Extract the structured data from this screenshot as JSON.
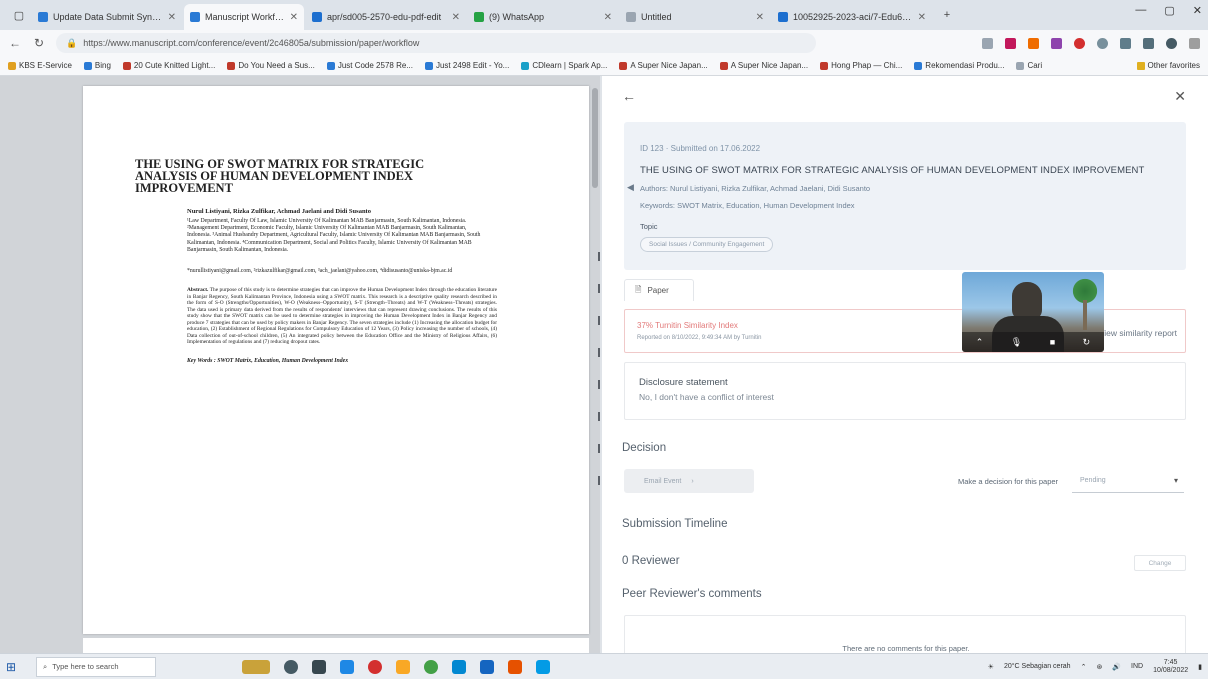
{
  "browser": {
    "tabs": [
      {
        "label": "Update Data Submit Synopsis",
        "color": "#2a7ad5",
        "active": false
      },
      {
        "label": "Manuscript Workflow",
        "color": "#2a7ad5",
        "active": true
      },
      {
        "label": "apr/sd005-2570-edu-pdf-edit",
        "color": "#1d6fcf",
        "active": false
      },
      {
        "label": "(9) WhatsApp",
        "color": "#25a244",
        "active": false
      },
      {
        "label": "Untitled",
        "color": "#9aa5b1",
        "active": false
      },
      {
        "label": "10052925-2023-aci/7-Edu6-PRt",
        "color": "#1d6fcf",
        "active": false
      }
    ],
    "url": "https://www.manuscript.com/conference/event/2c46805a/submission/paper/workflow",
    "bookmarks": [
      {
        "label": "KBS E-Service",
        "color": "#e0a020"
      },
      {
        "label": "Bing",
        "color": "#2a7ad5"
      },
      {
        "label": "20 Cute Knitted Light...",
        "color": "#c0392b"
      },
      {
        "label": "Do You Need a Sus...",
        "color": "#c0392b"
      },
      {
        "label": "Just Code 2578 Re...",
        "color": "#2a7ad5"
      },
      {
        "label": "Just 2498 Edit - Yo...",
        "color": "#2a7ad5"
      },
      {
        "label": "CDlearn | Spark Ap...",
        "color": "#1aa0c8"
      },
      {
        "label": "A Super Nice Japan...",
        "color": "#c0392b"
      },
      {
        "label": "A Super Nice Japan...",
        "color": "#c0392b"
      },
      {
        "label": "Hong Phap — Chi...",
        "color": "#c0392b"
      },
      {
        "label": "Rekomendasi Produ...",
        "color": "#2a7ad5"
      },
      {
        "label": "Cari",
        "color": "#9aa5b1"
      }
    ],
    "other_bookmarks": "Other favorites"
  },
  "paper_preview": {
    "title": "THE USING OF SWOT MATRIX FOR STRATEGIC ANALYSIS OF HUMAN DEVELOPMENT INDEX IMPROVEMENT",
    "authors": "Nurul Listiyani, Rizka Zulfikar, Achmad Jaelani and Didi Susanto",
    "affiliations": "¹Law Department, Faculty Of Law, Islamic University Of Kalimantan MAB Banjarmasin, South Kalimantan, Indonesia. ²Management Department, Economic Faculty, Islamic University Of Kalimantan MAB Banjarmasin, South Kalimantan, Indonesia. ³Animal Husbandry Department, Agricultural Faculty, Islamic University Of Kalimantan MAB Banjarmasin, South Kalimantan, Indonesia. ⁴Communication Department, Social and Politics Faculty, Islamic University Of Kalimantan MAB Banjarmasin, South Kalimantan, Indonesia.",
    "emails": "*nurullistiyani@gmail.com, ²rizkazulfikar@gmail.com, ³ach_jaelani@yahoo.com, ⁴didisusanto@uniska-bjm.ac.id",
    "abstract_label": "Abstract.",
    "abstract": "The purpose of this study is to determine strategies that can improve the Human Development Index through the education literature in Banjar Regency, South Kalimantan Province, Indonesia using a SWOT matrix. This research is a descriptive quality research described in the form of S-O (Strengths/Opportunities), W-O (Weakness–Opportunity), S-T (Strength–Threats) and W-T (Weakness–Threats) strategies. The data used is primary data derived from the results of respondents' interviews that can represent drawing conclusions. The results of this study show that the SWOT matrix can be used to determine strategies in improving the Human Development Index in Banjar Regency and produce 7 strategies that can be used by policy makers in Banjar Regency. The seven strategies include (1) Increasing the allocation budget for education, (2) Establishment of Regional Regulations for Compulsory Education of 12 Years, (3) Policy increasing the number of schools, (4) Data collection of out-of-school children, (5) An integrated policy between the Education Office and the Ministry of Religious Affairs, (6) Implementation of regulations and (7) reducing dropout rates.",
    "keywords": "Key Words : SWOT Matrix, Education, Human Development Index"
  },
  "panel": {
    "meta": "ID 123 · Submitted on 17.06.2022",
    "title": "THE USING OF SWOT MATRIX FOR STRATEGIC ANALYSIS OF HUMAN DEVELOPMENT INDEX IMPROVEMENT",
    "authors_line": "Authors: Nurul Listiyani, Rizka Zulfikar, Achmad Jaelani, Didi Susanto",
    "keywords_line": "Keywords: SWOT Matrix, Education, Human Development Index",
    "topic_label": "Topic",
    "topic_chip": "Social Issues / Community Engagement",
    "paper_tab": "Paper",
    "similarity_title": "37% Turnitin Similarity Index",
    "similarity_sub": "Reported on 8/10/2022, 9:49:34 AM by Turnitin",
    "similarity_link": "View similarity report",
    "disclosure_title": "Disclosure statement",
    "disclosure_text": "No, I don't have a conflict of interest",
    "decision_heading": "Decision",
    "email_button": "Email Event",
    "make_decision": "Make a decision for this paper",
    "decision_value": "Pending",
    "timeline_heading": "Submission Timeline",
    "reviewer_heading": "0 Reviewer",
    "change_button": "Change",
    "comments_heading": "Peer Reviewer's comments",
    "no_comments": "There are no comments for this paper."
  },
  "taskbar": {
    "search_placeholder": "Type here to search",
    "weather": "20°C Sebagian cerah",
    "time": "7:45",
    "date": "10/08/2022",
    "lang": "IND"
  },
  "colors": {
    "accent": "#2a7ad5",
    "warning": "#e27a7a"
  }
}
